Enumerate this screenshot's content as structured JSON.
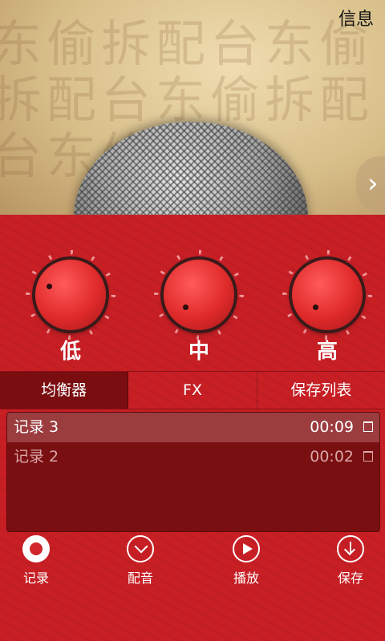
{
  "header": {
    "info_label": "信息"
  },
  "hero": {
    "background_glyphs": "东偷拆配台东偷拆配台东偷拆配台东偷"
  },
  "equalizer": {
    "knobs": [
      {
        "label": "低"
      },
      {
        "label": "中"
      },
      {
        "label": "高"
      }
    ]
  },
  "tabs": [
    {
      "label": "均衡器",
      "active": true
    },
    {
      "label": "FX"
    },
    {
      "label": "保存列表"
    }
  ],
  "recordings": [
    {
      "name": "记录 3",
      "duration": "00:09",
      "selected": true
    },
    {
      "name": "记录 2",
      "duration": "00:02"
    }
  ],
  "actions": [
    {
      "label": "记录",
      "icon": "record-icon"
    },
    {
      "label": "配音",
      "icon": "dub-icon"
    },
    {
      "label": "播放",
      "icon": "play-icon"
    },
    {
      "label": "保存",
      "icon": "download-icon"
    }
  ],
  "colors": {
    "panel": "#c81f25",
    "active_tab": "#7a0d10",
    "list_bg": "#7a0f12"
  }
}
